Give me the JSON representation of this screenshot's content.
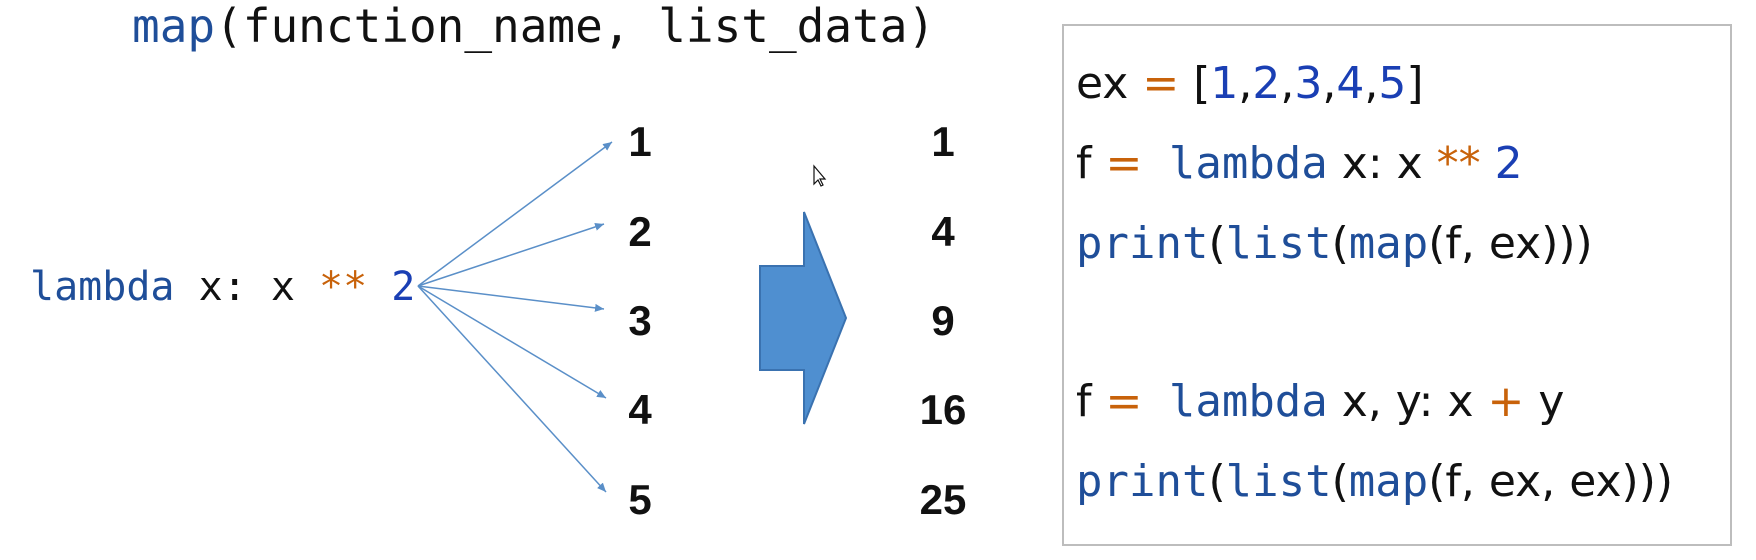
{
  "signature": {
    "func": "map",
    "args": "(function_name, list_data)"
  },
  "lambda_expr": {
    "kw": "lambda",
    "var": " x: x ",
    "op": "**",
    "num": " 2"
  },
  "inputs": [
    "1",
    "2",
    "3",
    "4",
    "5"
  ],
  "outputs": [
    "1",
    "4",
    "9",
    "16",
    "25"
  ],
  "arrow_color": "#5a8fc8",
  "big_arrow_color": "#4f8fd0",
  "code": {
    "line1": {
      "pre": "ex ",
      "eq": "=",
      "open": " [",
      "n1": "1",
      "c1": ",",
      "n2": "2",
      "c2": ",",
      "n3": "3",
      "c3": ",",
      "n4": "4",
      "c4": ",",
      "n5": "5",
      "close": "]"
    },
    "line2": {
      "pre": "f ",
      "eq": "=",
      "kw": " lambda",
      "rest": " x: x ",
      "op": "**",
      "num": " 2"
    },
    "line3": {
      "print": "print",
      "p1": "(",
      "list": "list",
      "p2": "(",
      "map": "map",
      "rest": "(f, ex)))"
    },
    "line4": {
      "pre": "f ",
      "eq": "=",
      "kw": " lambda",
      "rest": " x, y: x ",
      "op": "+",
      "rest2": " y"
    },
    "line5": {
      "print": "print",
      "p1": "(",
      "list": "list",
      "p2": "(",
      "map": "map",
      "rest": "(f, ex, ex)))"
    }
  }
}
